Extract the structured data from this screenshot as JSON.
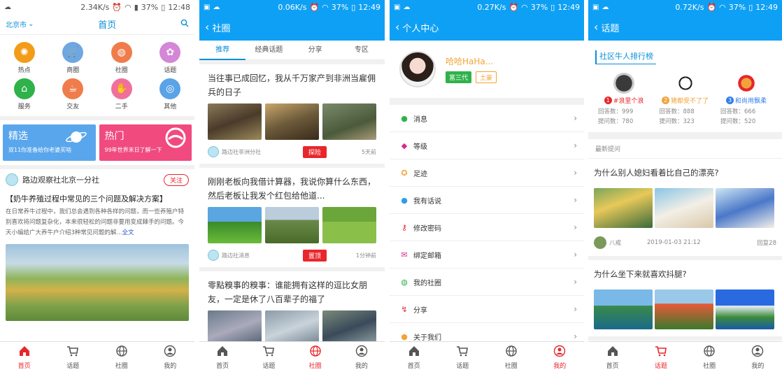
{
  "colors": {
    "blue": "#0ea0f5",
    "red": "#e8262c",
    "orange": "#f1a43a"
  },
  "s1": {
    "status": {
      "speed": "2.34K/s",
      "battery": "37%",
      "time": "12:48"
    },
    "header": {
      "city": "北京市",
      "title": "首页"
    },
    "grid": [
      {
        "label": "热点",
        "icon": "hot-icon",
        "color": "#f39c1a"
      },
      {
        "label": "商圈",
        "icon": "shop-icon",
        "color": "#6fa7e1"
      },
      {
        "label": "社圈",
        "icon": "globe-icon",
        "color": "#f07c4b"
      },
      {
        "label": "话题",
        "icon": "topic-icon",
        "color": "#d486d7"
      },
      {
        "label": "服务",
        "icon": "service-icon",
        "color": "#2fb24a"
      },
      {
        "label": "交友",
        "icon": "friend-icon",
        "color": "#f07c4b"
      },
      {
        "label": "二手",
        "icon": "hand-icon",
        "color": "#f0709b"
      },
      {
        "label": "其他",
        "icon": "other-icon",
        "color": "#5aa3e6"
      }
    ],
    "banners": [
      {
        "title": "精选",
        "sub": "双11你准备给你老婆买啥",
        "color": "#5aa6ec"
      },
      {
        "title": "热门",
        "sub": "99年世界末日了解一下",
        "color": "#f04a7e"
      }
    ],
    "post": {
      "author": "路边观察社北京一分社",
      "follow": "关注",
      "title": "【奶牛养殖过程中常见的三个问题及解决方案】",
      "body": "在日常养牛过程中，我们总会遇到各种各样的问题，而一些养殖户特别喜欢将问题复杂化，本来很轻松的问题非要用变成棘手的问题。今天小编给广大养牛户介绍3种常见问题的解...",
      "more": "全文"
    },
    "tabs": [
      "首页",
      "话题",
      "社圈",
      "我的"
    ]
  },
  "s2": {
    "status": {
      "speed": "0.06K/s",
      "battery": "37%",
      "time": "12:49"
    },
    "title": "社圈",
    "tabs": [
      "推荐",
      "经典话题",
      "分享",
      "专区"
    ],
    "articles": [
      {
        "title": "当往事已成回忆，我从千万家产到非洲当雇佣兵的日子",
        "source": "路边社非洲分社",
        "badge": "探险",
        "time": "5天前"
      },
      {
        "title": "刚刚老板向我借计算器，我说你算什么东西，然后老板让我发个红包给他道...",
        "source": "路边社消息",
        "badge": "置顶",
        "time": "1分钟前"
      },
      {
        "title": "零點糗事的糗事：谁能拥有这样的逗比女朋友，一定是休了八百辈子的福了"
      }
    ],
    "bottom_tabs": [
      "首页",
      "话题",
      "社圈",
      "我的"
    ]
  },
  "s3": {
    "status": {
      "speed": "0.27K/s",
      "battery": "37%",
      "time": "12:49"
    },
    "title": "个人中心",
    "user": {
      "name": "哈哈HaHa...",
      "tag1": "富三代",
      "tag2": "土豪"
    },
    "menu": [
      "消息",
      "等级",
      "足迹",
      "我有话说",
      "修改密码",
      "绑定邮箱",
      "我的社圈",
      "分享",
      "关于我们"
    ],
    "bottom_tabs": [
      "首页",
      "话题",
      "社圈",
      "我的"
    ]
  },
  "s4": {
    "status": {
      "speed": "0.72K/s",
      "battery": "37%",
      "time": "12:49"
    },
    "title": "话题",
    "rank_title": "社区牛人排行榜",
    "ranks": [
      {
        "num": "1",
        "name": "#浪里个浪",
        "answers": "回答数：999",
        "asks": "提问数：780",
        "color": "#e8262c"
      },
      {
        "num": "2",
        "name": "猪都受不了了",
        "answers": "回答数：888",
        "asks": "提问数：323",
        "color": "#f1a43a"
      },
      {
        "num": "3",
        "name": "和尚用飘柔",
        "answers": "回答数：666",
        "asks": "提问数：520",
        "color": "#2f7fe8"
      }
    ],
    "latest": "最新提问",
    "questions": [
      {
        "title": "为什么别人媳妇看着比自己的漂亮?",
        "user": "八戒",
        "date": "2019-01-03 21:12",
        "replies": "回复28"
      },
      {
        "title": "为什么坐下来就喜欢抖腿?"
      }
    ],
    "bottom_tabs": [
      "首页",
      "话题",
      "社圈",
      "我的"
    ]
  }
}
